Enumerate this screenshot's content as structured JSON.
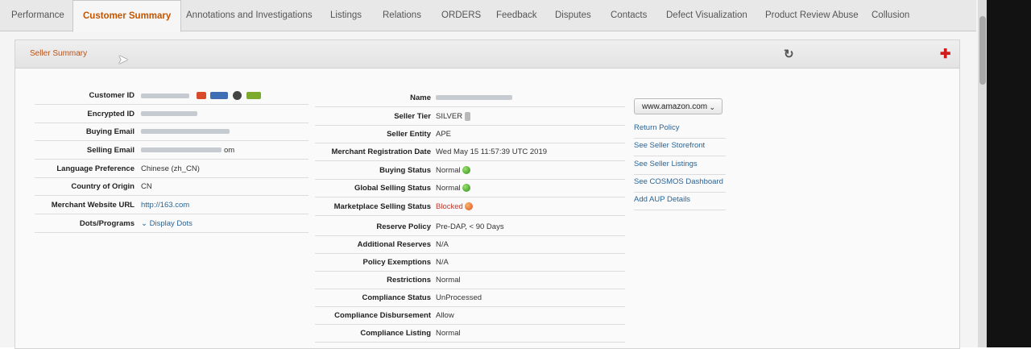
{
  "tabs": [
    {
      "label": "Performance"
    },
    {
      "label": "Customer Summary"
    },
    {
      "label": "Annotations and Investigations"
    },
    {
      "label": "Listings"
    },
    {
      "label": "Relations"
    },
    {
      "label": "ORDERS"
    },
    {
      "label": "Feedback"
    },
    {
      "label": "Disputes"
    },
    {
      "label": "Contacts"
    },
    {
      "label": "Defect Visualization"
    },
    {
      "label": "Product Review Abuse"
    },
    {
      "label": "Collusion"
    }
  ],
  "panel": {
    "title": "Seller Summary",
    "refresh_icon": "refresh-icon",
    "expand_icon": "plus-icon"
  },
  "left": {
    "customer_id": {
      "label": "Customer ID",
      "badges": [
        "flag-badge",
        "fulfillment-badge",
        "amazon-badge",
        "truck-badge"
      ]
    },
    "encrypted_id": {
      "label": "Encrypted ID"
    },
    "buying_email": {
      "label": "Buying Email"
    },
    "selling_email": {
      "label": "Selling Email",
      "tail": "om"
    },
    "language": {
      "label": "Language Preference",
      "value": "Chinese (zh_CN)"
    },
    "country": {
      "label": "Country of Origin",
      "value": "CN"
    },
    "website": {
      "label": "Merchant Website URL",
      "value": "http://163.com"
    },
    "dots": {
      "label": "Dots/Programs",
      "value": "Display Dots"
    }
  },
  "middle": {
    "name": {
      "label": "Name"
    },
    "seller_tier": {
      "label": "Seller Tier",
      "value": "SILVER"
    },
    "seller_entity": {
      "label": "Seller Entity",
      "value": "APE"
    },
    "registration_date": {
      "label": "Merchant Registration Date",
      "value": "Wed May 15 11:57:39 UTC 2019"
    },
    "buying_status": {
      "label": "Buying Status",
      "value": "Normal"
    },
    "global_selling_status": {
      "label": "Global Selling Status",
      "value": "Normal"
    },
    "marketplace_selling_status": {
      "label": "Marketplace Selling Status",
      "value": "Blocked"
    },
    "reserve_policy": {
      "label": "Reserve Policy",
      "value": "Pre-DAP, < 90 Days"
    },
    "additional_reserves": {
      "label": "Additional Reserves",
      "value": "N/A"
    },
    "policy_exemptions": {
      "label": "Policy Exemptions",
      "value": "N/A"
    },
    "restrictions": {
      "label": "Restrictions",
      "value": "Normal"
    },
    "compliance_status": {
      "label": "Compliance Status",
      "value": "UnProcessed"
    },
    "compliance_disbursement": {
      "label": "Compliance Disbursement",
      "value": "Allow"
    },
    "compliance_listing": {
      "label": "Compliance Listing",
      "value": "Normal"
    }
  },
  "right": {
    "marketplace_select": "www.amazon.com",
    "links": [
      {
        "label": "Return Policy"
      },
      {
        "label": "See Seller Storefront"
      },
      {
        "label": "See Seller Listings"
      },
      {
        "label": "See COSMOS Dashboard"
      },
      {
        "label": "Add AUP Details"
      }
    ]
  },
  "colors": {
    "accent": "#c45500",
    "link": "#2a6496",
    "blocked": "#c0392b",
    "status_green": "#2e8b1e"
  }
}
